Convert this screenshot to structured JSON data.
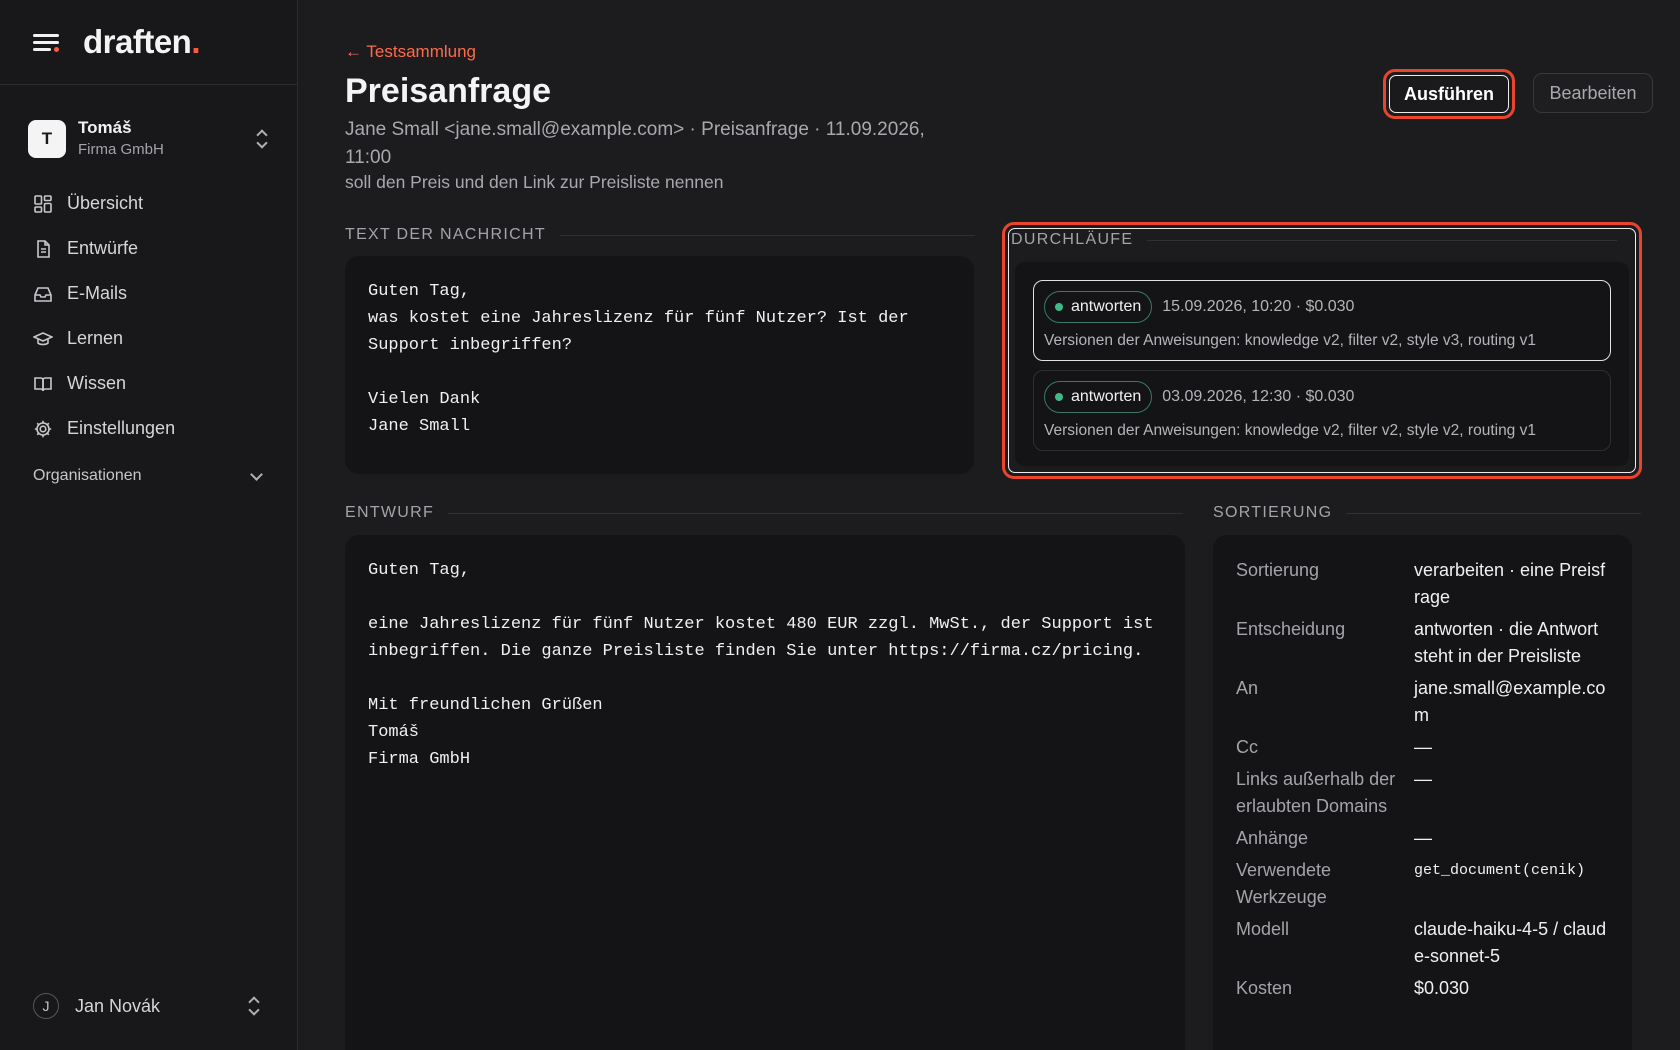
{
  "brand": {
    "name": "draften",
    "dot": "."
  },
  "account": {
    "initial": "T",
    "name": "Tomáš",
    "org": "Firma GmbH"
  },
  "nav": [
    {
      "label": "Übersicht",
      "icon": "dashboard-icon"
    },
    {
      "label": "Entwürfe",
      "icon": "document-icon"
    },
    {
      "label": "E-Mails",
      "icon": "inbox-icon"
    },
    {
      "label": "Lernen",
      "icon": "graduation-cap-icon"
    },
    {
      "label": "Wissen",
      "icon": "book-icon"
    },
    {
      "label": "Einstellungen",
      "icon": "gear-icon"
    }
  ],
  "nav_section": "Organisationen",
  "user": {
    "initial": "J",
    "name": "Jan Novák"
  },
  "header": {
    "back": "← Testsammlung",
    "title": "Preisanfrage",
    "meta": "Jane Small <jane.small@example.com> · Preisanfrage · 11.09.2026, 11:00",
    "subtitle": "soll den Preis und den Link zur Preisliste nennen",
    "run_button": "Ausführen",
    "edit_button": "Bearbeiten"
  },
  "message": {
    "label": "TEXT DER NACHRICHT",
    "body": "Guten Tag,\nwas kostet eine Jahreslizenz für fünf Nutzer? Ist der Support inbegriffen?\n\nVielen Dank\nJane Small"
  },
  "runs": {
    "label": "DURCHLÄUFE",
    "items": [
      {
        "status": "antworten",
        "when": "15.09.2026, 10:20 · $0.030",
        "versions": "Versionen der Anweisungen: knowledge v2, filter v2, style v3, routing v1"
      },
      {
        "status": "antworten",
        "when": "03.09.2026, 12:30 · $0.030",
        "versions": "Versionen der Anweisungen: knowledge v2, filter v2, style v2, routing v1"
      }
    ]
  },
  "draft": {
    "label": "ENTWURF",
    "body": "Guten Tag,\n\neine Jahreslizenz für fünf Nutzer kostet 480 EUR zzgl. MwSt., der Support ist inbegriffen. Die ganze Preisliste finden Sie unter https://firma.cz/pricing.\n\nMit freundlichen Grüßen\nTomáš\nFirma GmbH"
  },
  "sorting": {
    "label": "SORTIERUNG",
    "rows": [
      {
        "k": "Sortierung",
        "v": "verarbeiten · eine Preisfrage"
      },
      {
        "k": "Entscheidung",
        "v": "antworten · die Antwort steht in der Preisliste"
      },
      {
        "k": "An",
        "v": "jane.small@example.com"
      },
      {
        "k": "Cc",
        "v": "—"
      },
      {
        "k": "Links außerhalb der erlaubten Domains",
        "v": "—"
      },
      {
        "k": "Anhänge",
        "v": "—"
      },
      {
        "k": "Verwendete Werkzeuge",
        "v": "get_document(cenik)"
      },
      {
        "k": "Modell",
        "v": "claude-haiku-4-5 / claude-sonnet-5"
      },
      {
        "k": "Kosten",
        "v": "$0.030"
      }
    ]
  },
  "colors": {
    "accent": "#ff5a3c",
    "status_dot": "#3fb986",
    "background": "#1c1c1f"
  }
}
